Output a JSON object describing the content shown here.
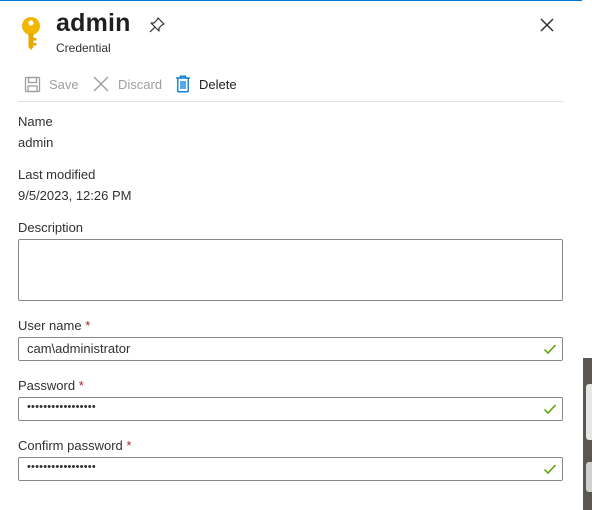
{
  "header": {
    "title": "admin",
    "subtitle": "Credential",
    "icons": {
      "resource": "key-icon",
      "pin": "pin-icon",
      "close": "close-icon"
    }
  },
  "toolbar": {
    "save_label": "Save",
    "discard_label": "Discard",
    "delete_label": "Delete"
  },
  "details": {
    "name_label": "Name",
    "name_value": "admin",
    "modified_label": "Last modified",
    "modified_value": "9/5/2023, 12:26 PM"
  },
  "form": {
    "description_label": "Description",
    "description_value": "",
    "username_label": "User name",
    "username_value": "cam\\administrator",
    "password_label": "Password",
    "password_value": "•••••••••••••••••",
    "confirm_label": "Confirm password",
    "confirm_value": "•••••••••••••••••",
    "required_mark": "*"
  },
  "colors": {
    "accent": "#0078d4",
    "key": "#f2b600",
    "required": "#a4262c",
    "valid": "#57a300",
    "delete_icon": "#0078d4"
  }
}
